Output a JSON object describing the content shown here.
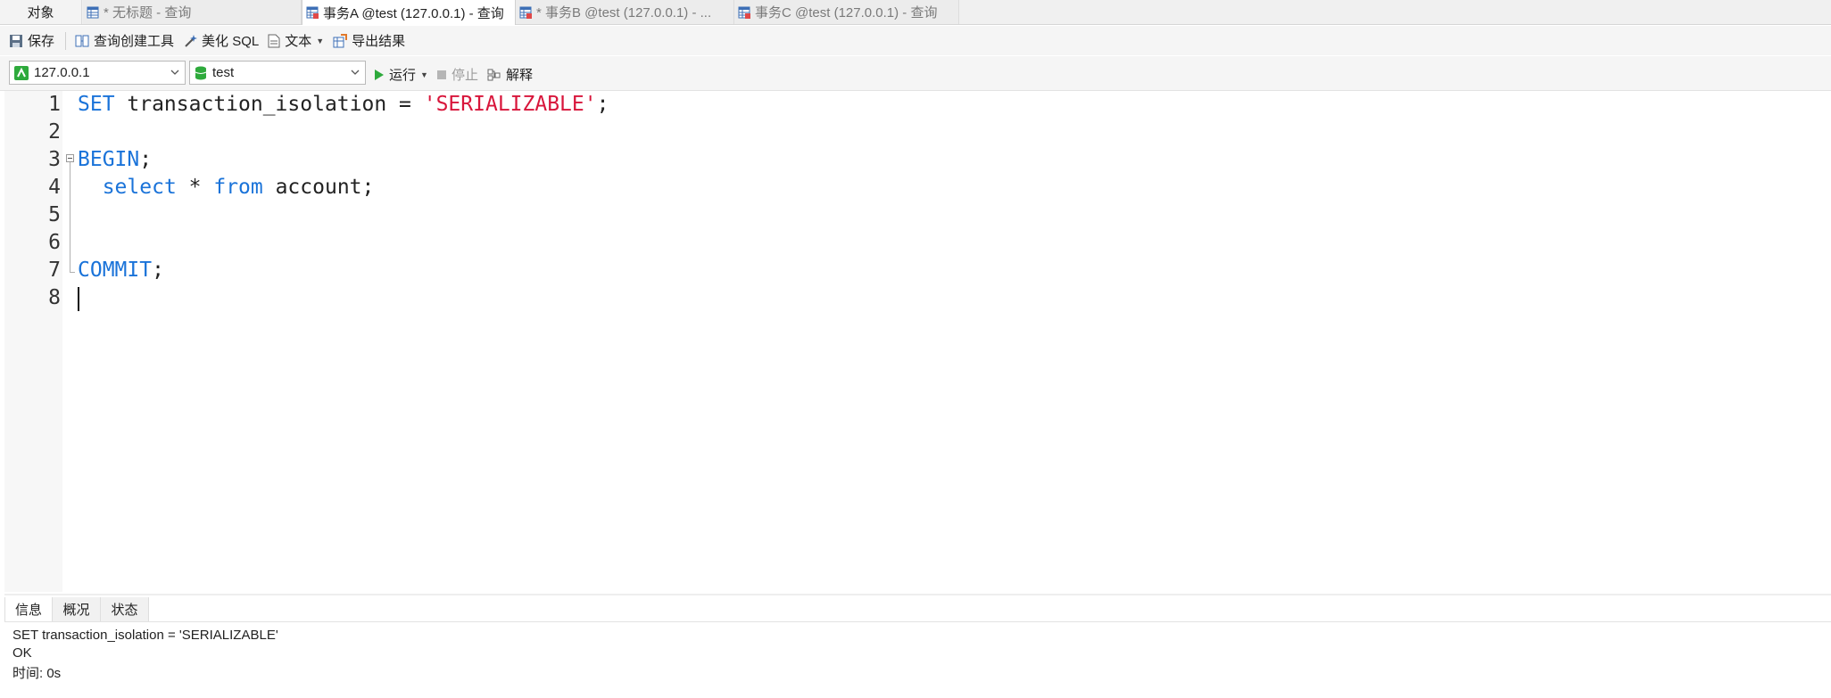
{
  "tabs": {
    "objects": "对象",
    "items": [
      {
        "label": "* 无标题 - 查询"
      },
      {
        "label": "事务A @test (127.0.0.1) - 查询"
      },
      {
        "label": "* 事务B @test (127.0.0.1) - ..."
      },
      {
        "label": "事务C @test (127.0.0.1) - 查询"
      }
    ],
    "active_index": 1
  },
  "toolbar": {
    "save": "保存",
    "query_builder": "查询创建工具",
    "beautify": "美化 SQL",
    "text": "文本",
    "export": "导出结果"
  },
  "connection": {
    "host": "127.0.0.1",
    "database": "test",
    "run": "运行",
    "stop": "停止",
    "explain": "解释"
  },
  "editor": {
    "line_numbers": [
      "1",
      "2",
      "3",
      "4",
      "5",
      "6",
      "7",
      "8"
    ],
    "l1": {
      "kw": "SET",
      "mid": " transaction_isolation = ",
      "str": "'SERIALIZABLE'",
      "end": ";"
    },
    "l3": {
      "kw": "BEGIN",
      "end": ";"
    },
    "l4": {
      "kw1": "select",
      "mid": " * ",
      "kw2": "from",
      "end": " account;"
    },
    "l7": {
      "kw": "COMMIT",
      "end": ";"
    }
  },
  "result": {
    "tabs": [
      "信息",
      "概况",
      "状态"
    ],
    "lines": [
      "SET transaction_isolation = 'SERIALIZABLE'",
      "OK",
      "时间: 0s"
    ]
  },
  "colors": {
    "keyword": "#1a73d9",
    "string": "#d8163b",
    "run_green": "#2eaa3c"
  }
}
